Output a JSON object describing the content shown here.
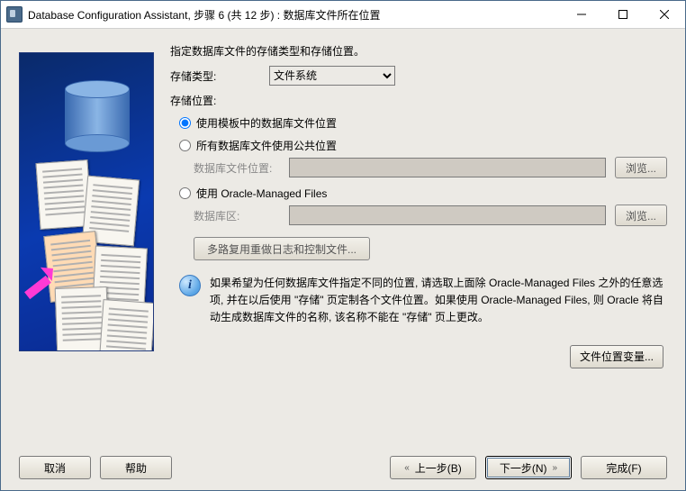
{
  "titlebar": {
    "title": "Database Configuration Assistant, 步骤 6 (共 12 步) : 数据库文件所在位置"
  },
  "form": {
    "intro": "指定数据库文件的存储类型和存储位置。",
    "storage_type_label": "存储类型:",
    "storage_type_value": "文件系统",
    "storage_type_options": [
      "文件系统"
    ],
    "storage_location_label": "存储位置:",
    "radio_template": "使用模板中的数据库文件位置",
    "radio_common": "所有数据库文件使用公共位置",
    "db_file_location_label": "数据库文件位置:",
    "db_file_location_value": "",
    "radio_omf": "使用 Oracle-Managed Files",
    "db_area_label": "数据库区:",
    "db_area_value": "",
    "browse_label": "浏览...",
    "mux_label": "多路复用重做日志和控制文件...",
    "info_text": "如果希望为任何数据库文件指定不同的位置, 请选取上面除 Oracle-Managed Files 之外的任意选项, 并在以后使用 \"存储\" 页定制各个文件位置。如果使用 Oracle-Managed Files, 则 Oracle 将自动生成数据库文件的名称, 该名称不能在 \"存储\" 页上更改。",
    "file_loc_vars_label": "文件位置变量..."
  },
  "buttons": {
    "cancel": "取消",
    "help": "帮助",
    "back": "上一步(B)",
    "next": "下一步(N)",
    "finish": "完成(F)"
  },
  "selected_radio": "template"
}
